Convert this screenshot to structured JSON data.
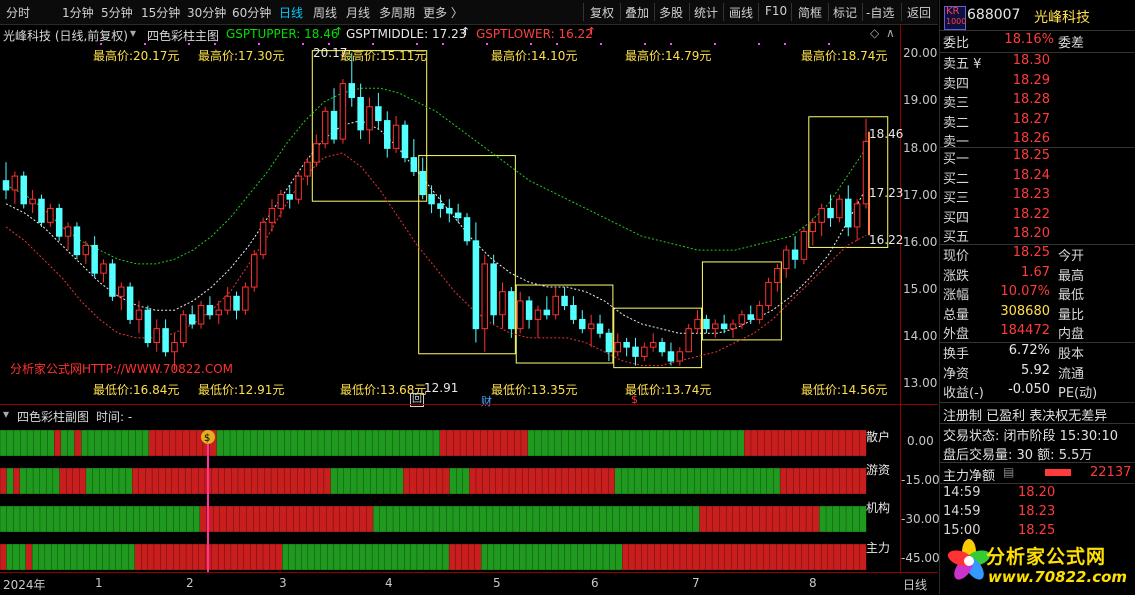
{
  "toolbar": {
    "periods": [
      "分时",
      "1分钟",
      "5分钟",
      "15分钟",
      "30分钟",
      "60分钟",
      "日线",
      "周线",
      "月线",
      "多周期",
      "更多 〉"
    ],
    "active_period": "日线",
    "actions": [
      "复权",
      "叠加",
      "多股",
      "统计",
      "画线",
      "F10",
      "简框",
      "标记",
      "-自选",
      "返回"
    ]
  },
  "main_chart": {
    "title": "光峰科技 (日线,前复权)",
    "indicator_name": "四色彩柱主图",
    "upper_label": "GSPTUPPER: 18.46",
    "middle_label": "GSPTMIDDLE: 17.23",
    "lower_label": "GSPTLOWER: 16.22",
    "watermark": "分析家公式网HTTP://WWW.70822.COM",
    "high_annotations": [
      "最高价:20.17元",
      "最高价:17.30元",
      "最高价:15.11元",
      "最高价:14.10元",
      "最高价:14.79元",
      "最高价:18.74元"
    ],
    "low_annotations": [
      "最低价:16.84元",
      "最低价:12.91元",
      "最低价:13.68元",
      "最低价:13.35元",
      "最低价:13.74元",
      "最低价:14.56元"
    ],
    "extra_low_label": "12.91",
    "peak_label": "20.17",
    "right_labels": [
      "18.46",
      "17.23",
      "16.22"
    ],
    "event_icons": [
      "回",
      "财",
      "$"
    ],
    "y_ticks": [
      "20.00",
      "19.00",
      "18.00",
      "17.00",
      "16.00",
      "15.00",
      "14.00",
      "13.00"
    ]
  },
  "sub_chart": {
    "title": "四色彩柱副图",
    "time_label": "时间: -",
    "row_labels": [
      "散户",
      "游资",
      "机构",
      "主力"
    ],
    "y_ticks": [
      "0.00",
      "-15.00",
      "-30.00",
      "-45.00"
    ],
    "coin_icon": "$"
  },
  "x_axis": {
    "year": "2024年",
    "months": [
      "1",
      "2",
      "3",
      "4",
      "5",
      "6",
      "7",
      "8"
    ],
    "period_label": "日线"
  },
  "chart_data": {
    "type": "candlestick",
    "y_range": [
      12.7,
      20.4
    ],
    "candles": [
      [
        17.4,
        17.8,
        17.0,
        17.2
      ],
      [
        17.2,
        17.6,
        16.9,
        17.5
      ],
      [
        17.5,
        17.6,
        16.8,
        16.9
      ],
      [
        16.9,
        17.2,
        16.7,
        17.0
      ],
      [
        17.0,
        17.1,
        16.4,
        16.5
      ],
      [
        16.5,
        16.9,
        16.4,
        16.8
      ],
      [
        16.8,
        16.9,
        16.1,
        16.2
      ],
      [
        16.2,
        16.5,
        15.9,
        16.4
      ],
      [
        16.4,
        16.5,
        15.7,
        15.8
      ],
      [
        15.8,
        16.1,
        15.6,
        16.0
      ],
      [
        16.0,
        16.2,
        15.3,
        15.4
      ],
      [
        15.4,
        15.7,
        15.2,
        15.6
      ],
      [
        15.6,
        15.7,
        14.8,
        14.9
      ],
      [
        14.9,
        15.2,
        14.6,
        15.1
      ],
      [
        15.1,
        15.2,
        14.3,
        14.4
      ],
      [
        14.4,
        14.8,
        14.1,
        14.6
      ],
      [
        14.6,
        14.7,
        13.8,
        13.9
      ],
      [
        13.9,
        14.4,
        13.7,
        14.2
      ],
      [
        14.2,
        14.4,
        13.6,
        13.7
      ],
      [
        13.7,
        14.1,
        13.3,
        13.9
      ],
      [
        13.9,
        14.6,
        13.8,
        14.5
      ],
      [
        14.5,
        14.7,
        14.2,
        14.3
      ],
      [
        14.3,
        14.8,
        14.2,
        14.7
      ],
      [
        14.7,
        14.9,
        14.4,
        14.5
      ],
      [
        14.5,
        14.8,
        14.3,
        14.6
      ],
      [
        14.6,
        15.1,
        14.5,
        14.9
      ],
      [
        14.9,
        15.0,
        14.4,
        14.6
      ],
      [
        14.6,
        15.2,
        14.5,
        15.1
      ],
      [
        15.1,
        15.9,
        15.0,
        15.8
      ],
      [
        15.8,
        16.6,
        15.7,
        16.5
      ],
      [
        16.5,
        17.0,
        16.3,
        16.8
      ],
      [
        16.8,
        17.2,
        16.6,
        17.1
      ],
      [
        17.1,
        17.3,
        16.8,
        17.0
      ],
      [
        17.0,
        17.6,
        16.9,
        17.5
      ],
      [
        17.5,
        17.9,
        17.3,
        17.8
      ],
      [
        17.8,
        18.4,
        17.7,
        18.2
      ],
      [
        18.2,
        19.0,
        18.1,
        18.9
      ],
      [
        18.9,
        19.4,
        18.2,
        18.3
      ],
      [
        18.3,
        19.6,
        18.2,
        19.5
      ],
      [
        19.5,
        20.17,
        19.0,
        19.2
      ],
      [
        19.2,
        19.5,
        18.3,
        18.5
      ],
      [
        18.5,
        19.2,
        18.2,
        19.0
      ],
      [
        19.0,
        19.3,
        18.5,
        18.7
      ],
      [
        18.7,
        18.9,
        17.9,
        18.1
      ],
      [
        18.1,
        18.8,
        18.0,
        18.6
      ],
      [
        18.6,
        18.7,
        17.8,
        17.9
      ],
      [
        17.9,
        18.3,
        17.5,
        17.6
      ],
      [
        17.6,
        17.9,
        17.0,
        17.1
      ],
      [
        17.1,
        17.3,
        16.7,
        16.9
      ],
      [
        16.9,
        17.1,
        16.6,
        16.8
      ],
      [
        16.8,
        17.0,
        16.5,
        16.7
      ],
      [
        16.7,
        16.9,
        16.5,
        16.6
      ],
      [
        16.6,
        16.7,
        16.0,
        16.1
      ],
      [
        16.1,
        16.5,
        13.9,
        14.2
      ],
      [
        14.2,
        15.8,
        13.7,
        15.6
      ],
      [
        15.6,
        15.8,
        14.3,
        14.5
      ],
      [
        14.5,
        15.2,
        14.2,
        15.0
      ],
      [
        15.0,
        15.1,
        14.0,
        14.2
      ],
      [
        14.2,
        15.0,
        14.1,
        14.8
      ],
      [
        14.8,
        14.9,
        14.2,
        14.4
      ],
      [
        14.4,
        14.7,
        14.0,
        14.6
      ],
      [
        14.6,
        14.9,
        14.4,
        14.5
      ],
      [
        14.5,
        15.1,
        14.4,
        14.9
      ],
      [
        14.9,
        15.1,
        14.6,
        14.7
      ],
      [
        14.7,
        14.9,
        14.3,
        14.4
      ],
      [
        14.4,
        14.6,
        14.1,
        14.2
      ],
      [
        14.2,
        14.5,
        13.8,
        14.3
      ],
      [
        14.3,
        14.5,
        14.0,
        14.1
      ],
      [
        14.1,
        14.2,
        13.5,
        13.7
      ],
      [
        13.7,
        14.1,
        13.6,
        13.9
      ],
      [
        13.9,
        14.0,
        13.6,
        13.8
      ],
      [
        13.8,
        14.0,
        13.4,
        13.6
      ],
      [
        13.6,
        13.9,
        13.5,
        13.8
      ],
      [
        13.8,
        14.1,
        13.7,
        13.9
      ],
      [
        13.9,
        14.0,
        13.6,
        13.7
      ],
      [
        13.7,
        13.9,
        13.4,
        13.5
      ],
      [
        13.5,
        13.8,
        13.4,
        13.7
      ],
      [
        13.7,
        14.3,
        13.7,
        14.2
      ],
      [
        14.2,
        14.6,
        14.1,
        14.4
      ],
      [
        14.4,
        14.5,
        14.1,
        14.2
      ],
      [
        14.2,
        14.4,
        14.0,
        14.3
      ],
      [
        14.3,
        14.5,
        14.1,
        14.2
      ],
      [
        14.2,
        14.4,
        14.0,
        14.3
      ],
      [
        14.3,
        14.6,
        14.2,
        14.5
      ],
      [
        14.5,
        14.7,
        14.3,
        14.4
      ],
      [
        14.4,
        14.8,
        14.3,
        14.7
      ],
      [
        14.7,
        15.3,
        14.6,
        15.2
      ],
      [
        15.2,
        15.6,
        15.0,
        15.5
      ],
      [
        15.5,
        16.0,
        15.3,
        15.9
      ],
      [
        15.9,
        16.2,
        15.5,
        15.7
      ],
      [
        15.7,
        16.4,
        15.6,
        16.3
      ],
      [
        16.3,
        16.6,
        16.0,
        16.5
      ],
      [
        16.5,
        16.9,
        16.2,
        16.8
      ],
      [
        16.8,
        17.1,
        16.4,
        16.6
      ],
      [
        16.6,
        17.1,
        16.5,
        17.0
      ],
      [
        17.0,
        17.3,
        16.2,
        16.4
      ],
      [
        16.4,
        17.0,
        16.1,
        16.9
      ],
      [
        16.9,
        18.74,
        16.8,
        18.25
      ]
    ],
    "upper_band": [
      17.3,
      17.1,
      16.8,
      16.4,
      16.1,
      15.9,
      15.7,
      15.6,
      15.6,
      15.7,
      15.9,
      16.2,
      16.6,
      17.1,
      17.6,
      18.2,
      18.7,
      19.1,
      19.3,
      19.4,
      19.4,
      19.3,
      19.1,
      18.9,
      18.6,
      18.3,
      18.0,
      17.7,
      17.4,
      17.2,
      17.0,
      16.8,
      16.6,
      16.4,
      16.2,
      16.1,
      16.0,
      15.9,
      15.9,
      15.9,
      16.0,
      16.1,
      16.2,
      16.5,
      16.9,
      17.5,
      18.1
    ],
    "middle_band": [
      16.9,
      16.7,
      16.4,
      16.0,
      15.6,
      15.2,
      14.9,
      14.7,
      14.6,
      14.6,
      14.8,
      15.1,
      15.5,
      16.0,
      16.6,
      17.2,
      17.8,
      18.3,
      18.6,
      18.7,
      18.5,
      18.1,
      17.6,
      17.1,
      16.6,
      16.1,
      15.7,
      15.4,
      15.2,
      15.1,
      15.1,
      15.0,
      14.8,
      14.5,
      14.3,
      14.2,
      14.1,
      14.1,
      14.1,
      14.2,
      14.4,
      14.6,
      14.9,
      15.3,
      15.8,
      16.5,
      17.23
    ],
    "lower_band": [
      16.4,
      16.1,
      15.7,
      15.3,
      14.8,
      14.4,
      14.1,
      14.0,
      14.0,
      14.1,
      14.3,
      14.6,
      15.0,
      15.6,
      16.2,
      16.9,
      17.5,
      17.9,
      18.0,
      17.7,
      17.2,
      16.6,
      16.0,
      15.5,
      15.0,
      14.6,
      14.3,
      14.1,
      14.0,
      14.0,
      14.0,
      13.9,
      13.7,
      13.5,
      13.4,
      13.4,
      13.5,
      13.6,
      13.7,
      13.9,
      14.1,
      14.4,
      14.8,
      15.2,
      15.6,
      16.0,
      16.22
    ],
    "sub_rows": [
      "GGGGGGGGRGGRGGGGGGGGGGRRRRRRRRRRGGGGGGGGGGGGGGGGGGGGGGGGGGGGGGGGGRRRRRRRRRRRRRGGGGGGGGGGGGGGGGGGGGGGGGGGGGGGGGRRRRRRRRRRRRRRRRRR",
      "RGRGGGGGGRRRRGGGGGGGRRRRRRRRRRRRRRRRRRRRRRRRRRRRRRGGGGGGGGGGGRRRRRRRGGGRRRRRRRRRRRRRRRRRRRRRRGGGGGGGGGGGGGGGGGGGGGGGGGRRRRRRRRRRRRR",
      "GGGGGGGGGGGGGGGGGGGGGGGGGGGGGGRRRRRRRRRRRRRRRRRRRRRRRRRRGGGGGGGGGGGGGGGGGGGGGGGGGGGGGGGGGGGGGGGGGGGGGGGGGRRRRRRRRRRRRRRRRRRGGGGGGG",
      "RGGGRGGGGGGGGGGGGGGGGRRRRRRRRRRRRRRRRRRRRRRRGGGGGGGGGGGGGGGGGGGGGGGGGGRRRRRGGGGGGGGGGGGGGGGGGGGGGRRRRRRRRRRRRRRRRRRRRRRRRRRRRRRRRRRRRRR"
    ]
  },
  "quote_panel": {
    "code": "688007",
    "name": "光峰科技",
    "badge": "KR",
    "badge_sub": "1000",
    "wei_bi_label": "委比",
    "wei_bi": "18.16%",
    "wei_cha_label": "委差",
    "asks": [
      {
        "label": "卖五 ¥",
        "price": "18.30"
      },
      {
        "label": "卖四",
        "price": "18.29"
      },
      {
        "label": "卖三",
        "price": "18.28"
      },
      {
        "label": "卖二",
        "price": "18.27"
      },
      {
        "label": "卖一",
        "price": "18.26"
      }
    ],
    "bids": [
      {
        "label": "买一",
        "price": "18.25"
      },
      {
        "label": "买二",
        "price": "18.24"
      },
      {
        "label": "买三",
        "price": "18.23"
      },
      {
        "label": "买四",
        "price": "18.22"
      },
      {
        "label": "买五",
        "price": "18.20"
      }
    ],
    "stats": [
      {
        "k": "现价",
        "v": "18.25",
        "k2": "今开",
        "color": "red"
      },
      {
        "k": "涨跌",
        "v": "1.67",
        "k2": "最高",
        "color": "red"
      },
      {
        "k": "涨幅",
        "v": "10.07%",
        "k2": "最低",
        "color": "red"
      },
      {
        "k": "总量",
        "v": "308680",
        "k2": "量比",
        "color": "yellow"
      },
      {
        "k": "外盘",
        "v": "184472",
        "k2": "内盘",
        "color": "red"
      },
      {
        "k": "换手",
        "v": "6.72%",
        "k2": "股本",
        "color": "white"
      },
      {
        "k": "净资",
        "v": "5.92",
        "k2": "流通",
        "color": "white"
      },
      {
        "k": "收益(-)",
        "v": "-0.050",
        "k2": "PE(动)",
        "color": "white"
      }
    ],
    "status_line": "注册制 已盈利 表决权无差异",
    "trade_state": "交易状态: 闭市阶段 15:30:10",
    "after_hours": "盘后交易量: 30  额: 5.5万",
    "net_flow_label": "主力净额",
    "net_flow_value": "22137",
    "ticks": [
      {
        "time": "14:59",
        "price": "18.20"
      },
      {
        "time": "14:59",
        "price": "18.23"
      },
      {
        "time": "15:00",
        "price": "18.25"
      }
    ],
    "logo_text": "分析家公式网",
    "logo_url": "www.70822.com"
  }
}
